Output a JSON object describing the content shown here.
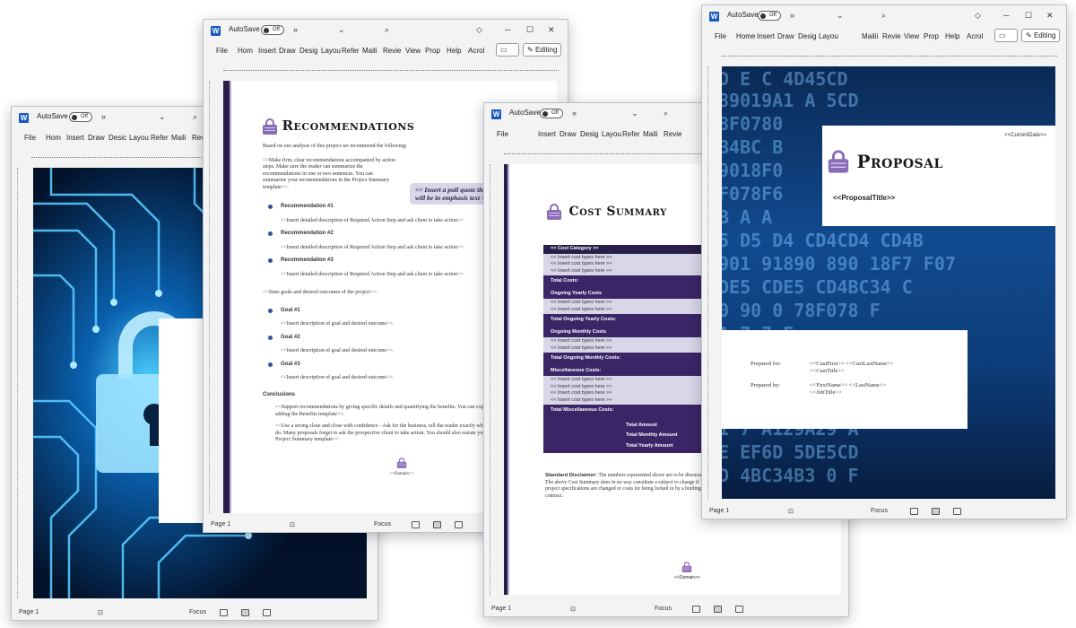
{
  "common": {
    "autosave": "AutoSave",
    "off": "Off",
    "chevrons": "»",
    "menu": [
      "File",
      "Home",
      "Insert",
      "Draw",
      "Design",
      "Layout",
      "References",
      "Mailings",
      "Review",
      "View",
      "Properties",
      "Help",
      "Acrobat"
    ],
    "menu_short": [
      "File",
      "Hom",
      "Insert",
      "Draw",
      "Desig",
      "Layou",
      "Refer",
      "Mailii",
      "Revie",
      "View",
      "Prop",
      "Help",
      "Acrol"
    ],
    "editing": "Editing",
    "page": "Page 1",
    "focus": "Focus"
  },
  "win1": {
    "menu": [
      "File",
      "Hom",
      "Insert",
      "Draw",
      "Desic",
      "Layou",
      "Refer",
      "Maili",
      "Rev"
    ]
  },
  "win2": {
    "menu": [
      "File",
      "Hom",
      "Insert",
      "Draw",
      "Desig",
      "Layou",
      "Refer",
      "Maili",
      "Revie",
      "View",
      "Prop",
      "Help",
      "Acrol"
    ],
    "doc": {
      "title": "Recommendations",
      "intro": "Based on our analysis of this project we recommend the following:",
      "para1": "<<Make firm, clear recommendations accompanied by action steps. Make sure the reader can summarize the recommendations in one or two sentences. You can summarize your recommendations in the Project Summary template>>.",
      "pullquote": "<< Insert a pull quote that will be in emphasis text >>",
      "recs": [
        {
          "title": "Recommendation #1",
          "desc": "<<Insert detailed description of Required Action Step and ask client to take action>>"
        },
        {
          "title": "Recommendation #2",
          "desc": "<<Insert detailed description of Required Action Step and ask client to take action>>"
        },
        {
          "title": "Recommendation #3",
          "desc": "<<Insert detailed description of Required Action Step and ask client to take action>>"
        }
      ],
      "goals_intro": "<<State goals and desired outcomes of the project>>.",
      "goals": [
        {
          "title": "Goal #1",
          "desc": "<<Insert description of goal and desired outcome>>."
        },
        {
          "title": "Goal #2",
          "desc": "<<Insert description of goal and desired outcome>>."
        },
        {
          "title": "Goal #3",
          "desc": "<<Insert description of goal and desired outcome>>."
        }
      ],
      "conclusions": "Conclusions",
      "conc1": "<<Support recommendations by giving specific details and quantifying the benefits. You can expand on the benefits by adding the Benefits template>>.",
      "conc2": "<<Use a strong close and close with confidence - Ask for the business, tell the reader exactly what you want him or her to do. Many proposals forget to ask the prospective client to take action. You should also restate your request for action in the Project Summary template>>.",
      "domain": "<<Domain>>"
    }
  },
  "win3": {
    "menu": [
      "File",
      "Insert",
      "Draw",
      "Desig",
      "Layou",
      "Refer",
      "Maili",
      "Revie"
    ],
    "doc": {
      "title": "Cost Summary",
      "header": "<< Cost Category >>",
      "cost_line": "<< Insert cost types here >>",
      "total_costs": "Total Costs:",
      "ongoing_yearly": "Ongoing Yearly Costs",
      "total_ongoing_yearly": "Total Ongoing Yearly Costs:",
      "ongoing_monthly": "Ongoing Monthly Costs",
      "total_ongoing_monthly": "Total Ongoing Monthly Costs:",
      "misc": "Miscellaneous Costs:",
      "total_misc": "Total Miscellaneous Costs:",
      "total_amount": "Total Amount",
      "total_monthly_amount": "Total Monthly Amount",
      "total_yearly_amount": "Total Yearly Amount",
      "disclaimer_label": "Standard Disclaimer:",
      "disclaimer_text": "The numbers represented above are to be discussed. The above Cost Summary does in no way constitute a subject to change if project specifications are changed or costs for being locked in by a binding contract.",
      "domain": "<<Domain>>"
    }
  },
  "win4": {
    "menu": [
      "File",
      "Home",
      "Insert",
      "Draw",
      "Desig",
      "Layou",
      "Mailii",
      "Revie",
      "View",
      "Prop",
      "Help",
      "Acrol"
    ],
    "doc": {
      "current_date": "<<CurrentDate>>",
      "title": "Proposal",
      "proposal_title": "<<ProposalTitle>>",
      "prepared_for": "Prepared for:",
      "cust_name": "<<CustFirst>> <<CustLastName>>",
      "cust_title": "<<CustTitle>>",
      "prepared_by": "Prepared by:",
      "by_name": "<<FirstName>> <<LastName>>",
      "job_title": "<<JobTitle>>"
    }
  },
  "colors": {
    "navy": "#2a1f4a",
    "purple": "#3a2566",
    "lavender": "#d9d6e8",
    "accent": "#8a6bb8",
    "word_blue": "#185abd"
  }
}
